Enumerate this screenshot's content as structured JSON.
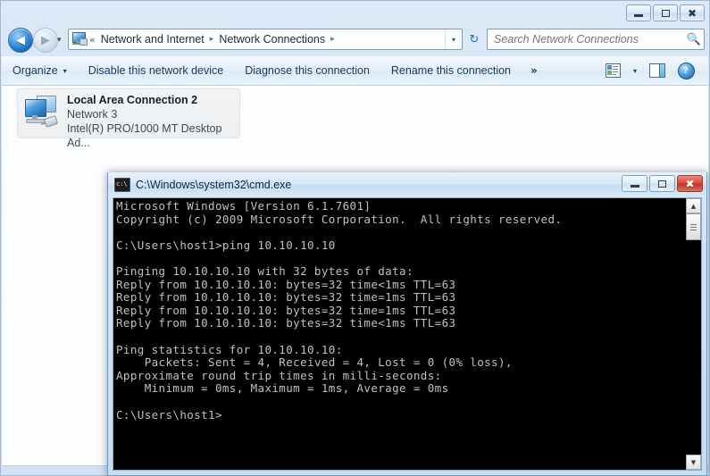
{
  "explorer": {
    "window_buttons": {
      "minimize": "minimize-button",
      "maximize": "maximize-button",
      "close": "close-button"
    },
    "nav": {
      "back_glyph": "◀",
      "forward_glyph": "▶",
      "history_glyph": "▾",
      "address_icon": "network-connections-icon",
      "address_chevrons": "«",
      "breadcrumbs": [
        "Network and Internet",
        "Network Connections"
      ],
      "breadcrumb_sep": "▸",
      "address_dropdown_glyph": "▾",
      "refresh_glyph": "↻"
    },
    "search": {
      "placeholder": "Search Network Connections",
      "value": "",
      "icon": "search-icon"
    },
    "toolbar": {
      "organize": "Organize",
      "organize_caret": "▾",
      "disable_device": "Disable this network device",
      "diagnose": "Diagnose this connection",
      "rename": "Rename this connection",
      "overflow": "»",
      "view_caret": "▾",
      "help_glyph": "?"
    },
    "connection": {
      "name": "Local Area Connection 2",
      "network": "Network  3",
      "adapter": "Intel(R) PRO/1000 MT Desktop Ad..."
    }
  },
  "cmd": {
    "title": "C:\\Windows\\system32\\cmd.exe",
    "icon": "cmd-console-icon",
    "window_buttons": {
      "minimize": "minimize-button",
      "maximize": "maximize-button",
      "close": "close-button"
    },
    "scrollbar": {
      "up_glyph": "▲",
      "down_glyph": "▼"
    },
    "console_text": "Microsoft Windows [Version 6.1.7601]\nCopyright (c) 2009 Microsoft Corporation.  All rights reserved.\n\nC:\\Users\\host1>ping 10.10.10.10\n\nPinging 10.10.10.10 with 32 bytes of data:\nReply from 10.10.10.10: bytes=32 time<1ms TTL=63\nReply from 10.10.10.10: bytes=32 time=1ms TTL=63\nReply from 10.10.10.10: bytes=32 time=1ms TTL=63\nReply from 10.10.10.10: bytes=32 time<1ms TTL=63\n\nPing statistics for 10.10.10.10:\n    Packets: Sent = 4, Received = 4, Lost = 0 (0% loss),\nApproximate round trip times in milli-seconds:\n    Minimum = 0ms, Maximum = 1ms, Average = 0ms\n\nC:\\Users\\host1>"
  }
}
